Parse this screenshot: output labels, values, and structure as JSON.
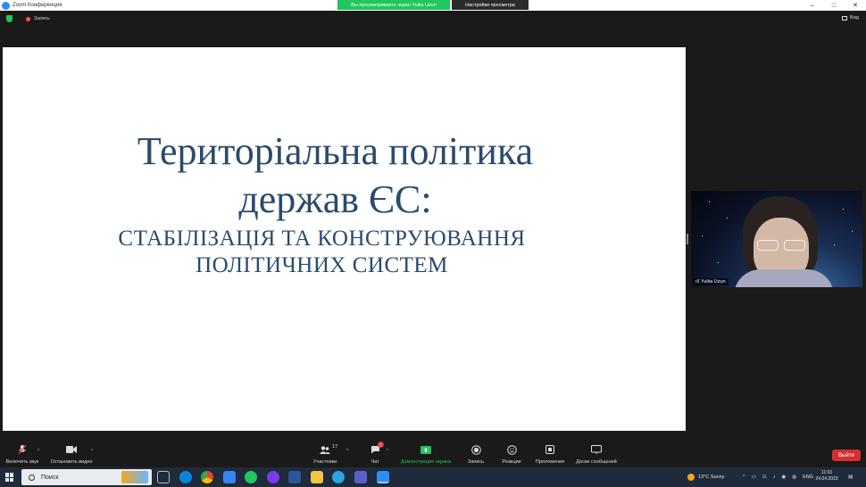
{
  "window": {
    "title": "Zoom Конференция",
    "share_banner": "Вы просматриваете экран Yuliia Uzun",
    "view_options": "Настройки просмотра",
    "controls": [
      "–",
      "□",
      "✕"
    ]
  },
  "status": {
    "recording_label": "Запись",
    "view_label": "Вид"
  },
  "slide": {
    "title_line1": "Територіальна політика",
    "title_line2": "держав ЄС:",
    "subtitle_line1": "СТАБІЛІЗАЦІЯ ТА КОНСТРУЮВАННЯ",
    "subtitle_line2": "ПОЛІТИЧНИХ СИСТЕМ"
  },
  "video": {
    "participant_name": "Yuliia Uzun"
  },
  "toolbar": {
    "unmute_label": "Включить звук",
    "stop_video_label": "Остановить видео",
    "participants_label": "Участники",
    "participants_count": "17",
    "chat_label": "Чат",
    "chat_badge": "1",
    "share_label": "Демонстрация экрана",
    "record_label": "Запись",
    "reactions_label": "Реакции",
    "apps_label": "Приложения",
    "whiteboard_label": "Доски сообщений",
    "leave_label": "Выйти",
    "colors": {
      "accent_green": "#22c55e",
      "leave_red": "#d32f2f"
    }
  },
  "taskbar": {
    "search_label": "Поиск",
    "weather": "13°C  Sunny",
    "language": "ENG",
    "time": "11:03",
    "date": "24.04.2023"
  }
}
